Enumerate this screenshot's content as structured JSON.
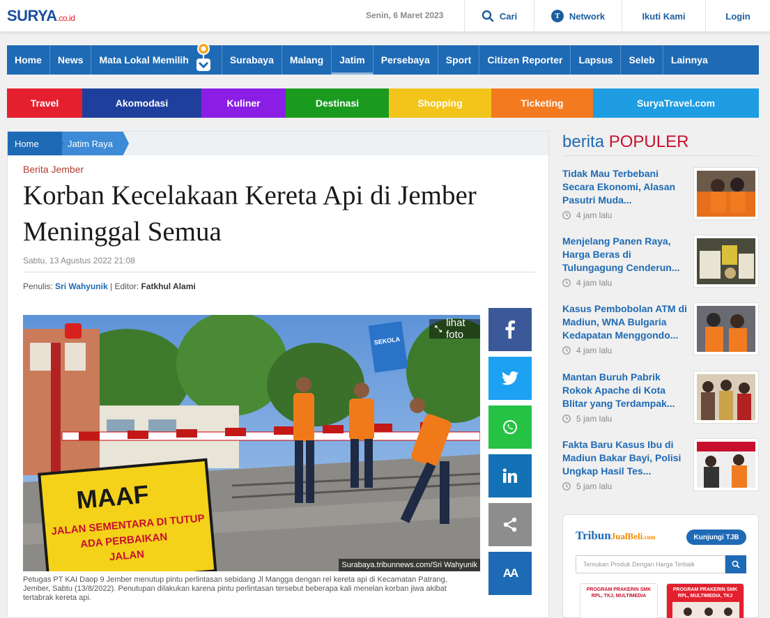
{
  "header": {
    "logo_main": "SURYA",
    "logo_suffix": ".co.id",
    "date": "Senin, 6 Maret 2023",
    "search_label": "Cari",
    "network_label": "Network",
    "follow_label": "Ikuti Kami",
    "login_label": "Login"
  },
  "main_nav": {
    "items": [
      "Home",
      "News",
      "Mata Lokal Memilih",
      "Surabaya",
      "Malang",
      "Jatim",
      "Persebaya",
      "Sport",
      "Citizen Reporter",
      "Lapsus",
      "Seleb",
      "Lainnya"
    ],
    "active": "Jatim"
  },
  "travel_nav": {
    "items": [
      {
        "label": "Travel",
        "color": "#e5202e"
      },
      {
        "label": "Akomodasi",
        "color": "#1e3f9c"
      },
      {
        "label": "Kuliner",
        "color": "#8a1ee5"
      },
      {
        "label": "Destinasi",
        "color": "#1a9b1f"
      },
      {
        "label": "Shopping",
        "color": "#f3c51a"
      },
      {
        "label": "Ticketing",
        "color": "#f47a20"
      },
      {
        "label": "SuryaTravel.com",
        "color": "#1e9de2"
      }
    ]
  },
  "breadcrumb": [
    "Home",
    "Jatim Raya"
  ],
  "article": {
    "kicker": "Berita Jember",
    "title": "Korban Kecelakaan Kereta Api di Jember Meninggal Semua",
    "date": "Sabtu, 13 Agustus 2022 21:08",
    "writer_label": "Penulis:",
    "writer": "Sri Wahyunik",
    "sep": "|",
    "editor_label": "Editor:",
    "editor": "Fatkhul Alami",
    "view_photo": "lihat foto",
    "photo_credit": "Surabaya.tribunnews.com/Sri Wahyunik",
    "photo_sign": [
      "MAAF",
      "JALAN SEMENTARA DI TUTUP",
      "ADA PERBAIKAN",
      "JALAN"
    ],
    "station_sign": "SEKOLA",
    "caption": "Petugas PT KAI Daop 9 Jember menutup pintu perlintasan sebidang Jl Mangga dengan rel kereta api di Kecamatan Patrang, Jember, Sabtu (13/8/2022). Penutupan dilakukan karena pintu perlintasan tersebut beberapa kali menelan korban jiwa akibat tertabrak kereta api."
  },
  "share": {
    "font_size_label": "AA"
  },
  "sidebar": {
    "popular_prefix": "berita",
    "popular_highlight": "POPULER",
    "items": [
      {
        "title": "Tidak Mau Terbebani Secara Ekonomi, Alasan Pasutri Muda...",
        "time": "4 jam lalu"
      },
      {
        "title": "Menjelang Panen Raya, Harga Beras di Tulungagung Cenderun...",
        "time": "4 jam lalu"
      },
      {
        "title": "Kasus Pembobolan ATM di Madiun, WNA Bulgaria Kedapatan Menggondo...",
        "time": "4 jam lalu"
      },
      {
        "title": "Mantan Buruh Pabrik Rokok Apache di Kota Blitar yang Terdampak...",
        "time": "5 jam lalu"
      },
      {
        "title": "Fakta Baru Kasus Ibu di Madiun Bakar Bayi, Polisi Ungkap Hasil Tes...",
        "time": "5 jam lalu"
      }
    ],
    "tjb": {
      "logo_a": "Tribun",
      "logo_b": "JualBeli",
      "logo_c": ".com",
      "visit_label": "Kunjungi TJB",
      "search_placeholder": "Temukan Produk Dengan Harga Terbaik",
      "card1": "PROGRAM PRAKERIN SMK RPL, TKJ, MULTIMEDIA",
      "card2": "PROGRAM PRAKERIN SMK RPL, MULTIMEDIA, TKJ"
    }
  }
}
